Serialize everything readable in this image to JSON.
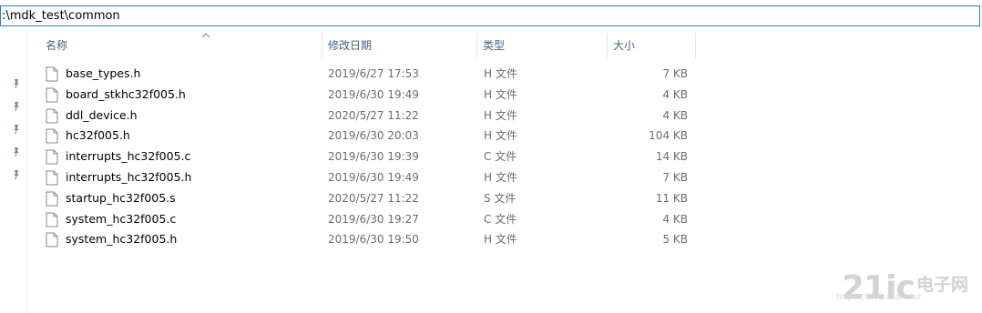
{
  "address": {
    "path": ":\\mdk_test\\common"
  },
  "columns": {
    "name": "名称",
    "date": "修改日期",
    "type": "类型",
    "size": "大小"
  },
  "icons": {
    "file": "document-icon",
    "pin": "pin-icon",
    "sort": "sort-ascending-icon"
  },
  "files": [
    {
      "name": "base_types.h",
      "date": "2019/6/27 17:53",
      "type": "H 文件",
      "size": "7 KB"
    },
    {
      "name": "board_stkhc32f005.h",
      "date": "2019/6/30 19:49",
      "type": "H 文件",
      "size": "4 KB"
    },
    {
      "name": "ddl_device.h",
      "date": "2020/5/27 11:22",
      "type": "H 文件",
      "size": "4 KB"
    },
    {
      "name": "hc32f005.h",
      "date": "2019/6/30 20:03",
      "type": "H 文件",
      "size": "104 KB"
    },
    {
      "name": "interrupts_hc32f005.c",
      "date": "2019/6/30 19:39",
      "type": "C 文件",
      "size": "14 KB"
    },
    {
      "name": "interrupts_hc32f005.h",
      "date": "2019/6/30 19:49",
      "type": "H 文件",
      "size": "7 KB"
    },
    {
      "name": "startup_hc32f005.s",
      "date": "2020/5/27 11:22",
      "type": "S 文件",
      "size": "11 KB"
    },
    {
      "name": "system_hc32f005.c",
      "date": "2019/6/30 19:27",
      "type": "C 文件",
      "size": "4 KB"
    },
    {
      "name": "system_hc32f005.h",
      "date": "2019/6/30 19:50",
      "type": "H 文件",
      "size": "5 KB"
    }
  ],
  "watermark": {
    "logo": "21ic",
    "brand": "电子网",
    "url": "https://blog.csdn.net"
  }
}
